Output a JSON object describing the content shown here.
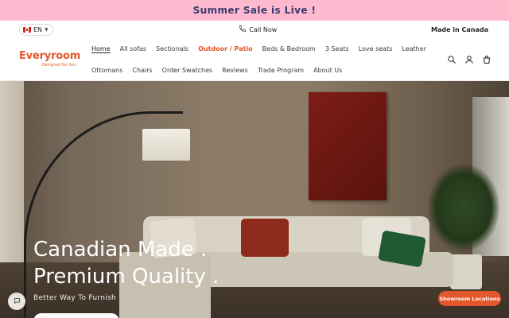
{
  "announcement": {
    "text": "Summer Sale is Live !"
  },
  "utility": {
    "language": "EN",
    "call": "Call Now",
    "made_in": "Made in Canada"
  },
  "brand": {
    "name": "Everyroom",
    "tagline": "Designed for You",
    "accent": "#e2572b"
  },
  "nav": {
    "row1": [
      "Home",
      "All sofas",
      "Sectionals",
      "Outdoor / Patio",
      "Beds & Bedroom",
      "3 Seats",
      "Love seats",
      "Leather"
    ],
    "row2": [
      "Ottomans",
      "Chairs",
      "Order Swatches",
      "Reviews",
      "Trade Program",
      "About Us"
    ]
  },
  "icons": [
    "search-icon",
    "account-icon",
    "cart-icon"
  ],
  "hero": {
    "title_line1": "Canadian Made .",
    "title_line2": "Premium Quality .",
    "subtitle": "Better Way To Furnish"
  },
  "floating": {
    "showroom": "Showroom Locations"
  },
  "colors": {
    "announcement_bg": "#fdb9cd",
    "announcement_text": "#3a3a6e",
    "accent": "#e2572b"
  }
}
